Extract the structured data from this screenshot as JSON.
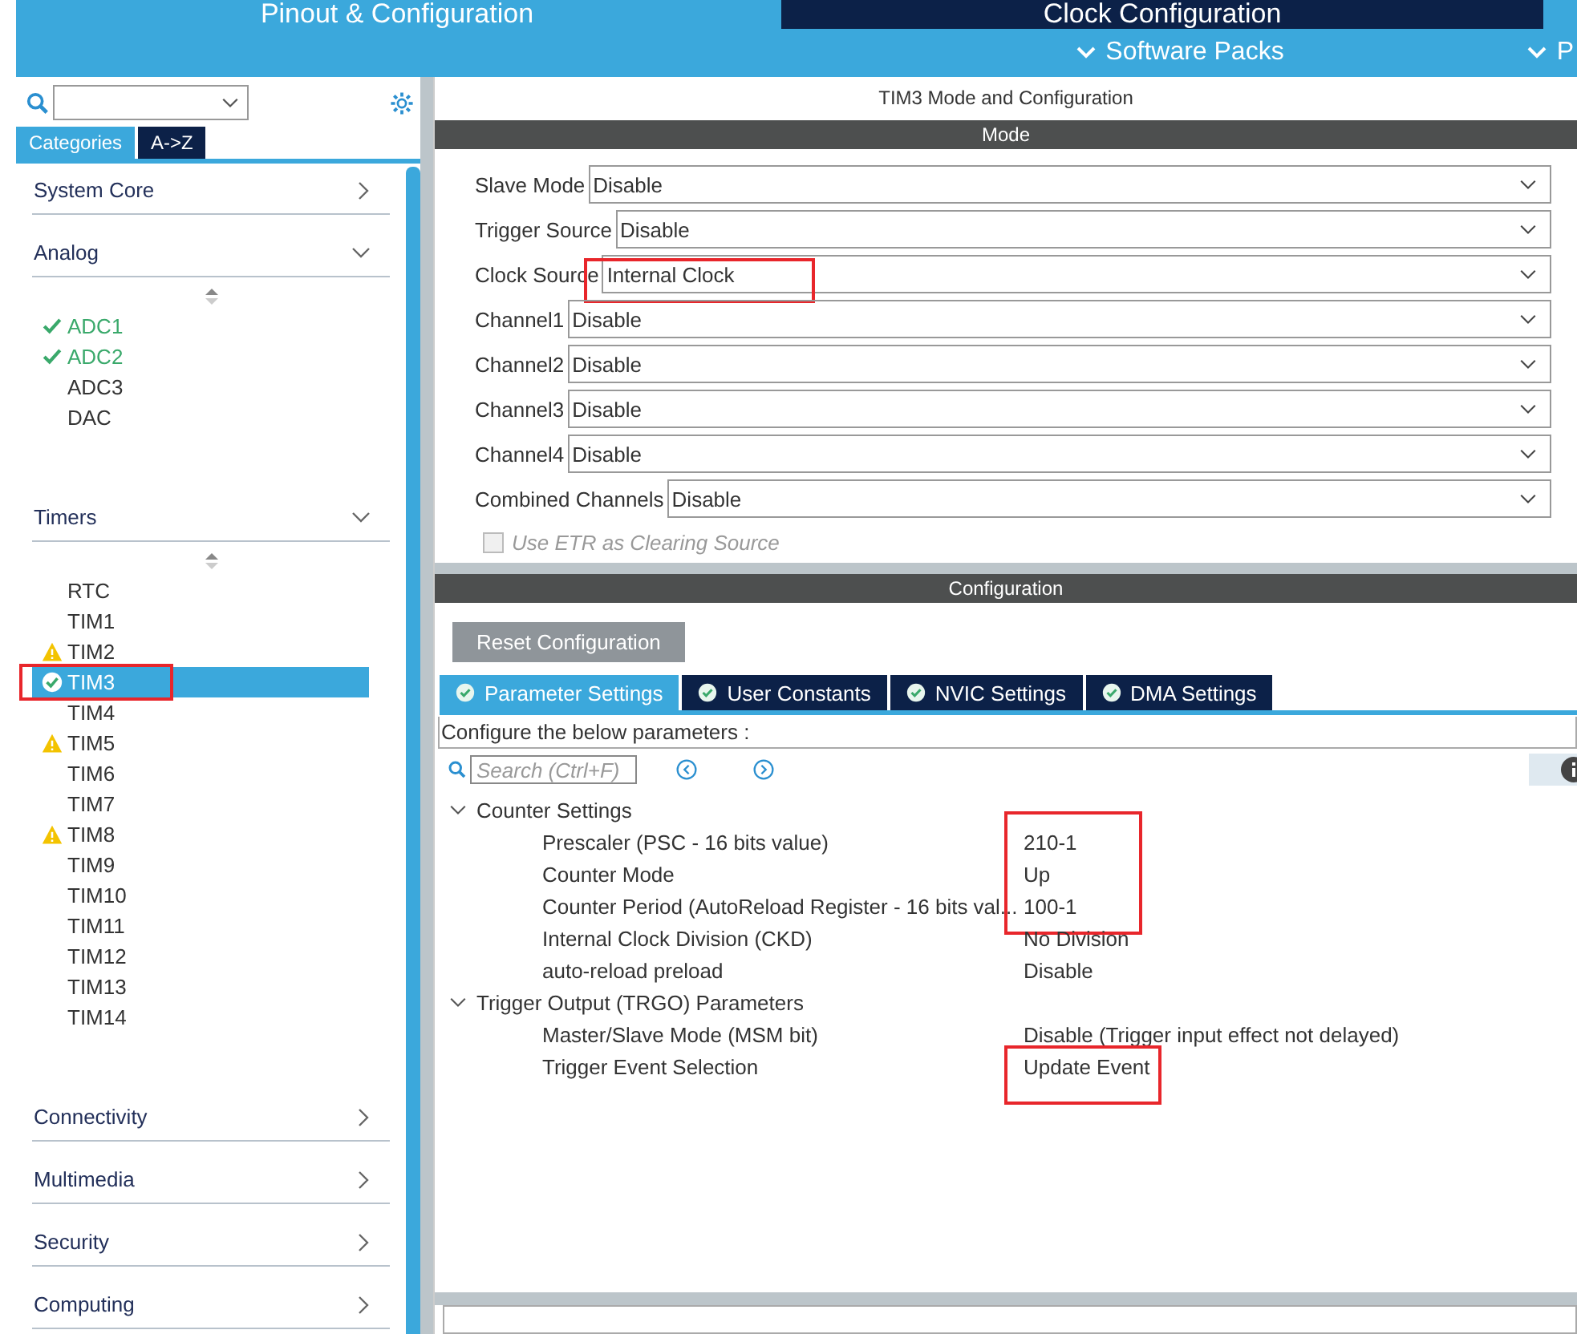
{
  "top_tabs": [
    {
      "label": "Pinout & Configuration",
      "selected": true
    },
    {
      "label": "Clock Configuration",
      "selected": false
    }
  ],
  "menus": [
    "Software Packs",
    "P"
  ],
  "sidebar": {
    "tabs": [
      {
        "label": "Categories",
        "selected": true
      },
      {
        "label": "A->Z",
        "selected": false
      }
    ],
    "groups": [
      {
        "label": "System Core",
        "expanded": false
      },
      {
        "label": "Analog",
        "expanded": true,
        "items": [
          {
            "label": "ADC1",
            "kind": "ok",
            "selected": false
          },
          {
            "label": "ADC2",
            "kind": "ok",
            "selected": false
          },
          {
            "label": "ADC3",
            "kind": "plain",
            "selected": false
          },
          {
            "label": "DAC",
            "kind": "plain",
            "selected": false
          }
        ]
      },
      {
        "label": "Timers",
        "expanded": true,
        "items": [
          {
            "label": "RTC",
            "kind": "plain",
            "selected": false
          },
          {
            "label": "TIM1",
            "kind": "plain",
            "selected": false
          },
          {
            "label": "TIM2",
            "kind": "warn",
            "selected": false
          },
          {
            "label": "TIM3",
            "kind": "ok",
            "selected": true,
            "highlighted": true
          },
          {
            "label": "TIM4",
            "kind": "plain",
            "selected": false
          },
          {
            "label": "TIM5",
            "kind": "warn",
            "selected": false
          },
          {
            "label": "TIM6",
            "kind": "plain",
            "selected": false
          },
          {
            "label": "TIM7",
            "kind": "plain",
            "selected": false
          },
          {
            "label": "TIM8",
            "kind": "warn",
            "selected": false
          },
          {
            "label": "TIM9",
            "kind": "plain",
            "selected": false
          },
          {
            "label": "TIM10",
            "kind": "plain",
            "selected": false
          },
          {
            "label": "TIM11",
            "kind": "plain",
            "selected": false
          },
          {
            "label": "TIM12",
            "kind": "plain",
            "selected": false
          },
          {
            "label": "TIM13",
            "kind": "plain",
            "selected": false
          },
          {
            "label": "TIM14",
            "kind": "plain",
            "selected": false
          }
        ]
      },
      {
        "label": "Connectivity",
        "expanded": false
      },
      {
        "label": "Multimedia",
        "expanded": false
      },
      {
        "label": "Security",
        "expanded": false
      },
      {
        "label": "Computing",
        "expanded": false
      }
    ]
  },
  "panel_title": "TIM3 Mode and Configuration",
  "mode": {
    "title": "Mode",
    "fields": [
      {
        "label": "Slave Mode",
        "value": "Disable"
      },
      {
        "label": "Trigger Source",
        "value": "Disable"
      },
      {
        "label": "Clock Source",
        "value": "Internal Clock",
        "highlighted": true
      },
      {
        "label": "Channel1",
        "value": "Disable"
      },
      {
        "label": "Channel2",
        "value": "Disable"
      },
      {
        "label": "Channel3",
        "value": "Disable"
      },
      {
        "label": "Channel4",
        "value": "Disable"
      },
      {
        "label": "Combined Channels",
        "value": "Disable"
      }
    ],
    "checkbox": {
      "label": "Use ETR as Clearing Source",
      "checked": false,
      "disabled": true
    }
  },
  "configuration": {
    "title": "Configuration",
    "reset_button": "Reset Configuration",
    "tabs": [
      {
        "label": "Parameter Settings",
        "selected": true
      },
      {
        "label": "User Constants",
        "selected": false
      },
      {
        "label": "NVIC Settings",
        "selected": false
      },
      {
        "label": "DMA Settings",
        "selected": false
      }
    ],
    "hint": "Configure the below parameters :",
    "search": {
      "placeholder": "Search (Ctrl+F)"
    },
    "groups": [
      {
        "label": "Counter Settings",
        "expanded": true,
        "params": [
          {
            "name": "Prescaler (PSC - 16 bits value)",
            "value": "210-1",
            "highlighted": true
          },
          {
            "name": "Counter Mode",
            "value": "Up",
            "highlighted": true
          },
          {
            "name": "Counter Period (AutoReload Register - 16 bits val...",
            "value": "100-1",
            "highlighted": true
          },
          {
            "name": "Internal Clock Division (CKD)",
            "value": "No Division"
          },
          {
            "name": "auto-reload preload",
            "value": "Disable"
          }
        ]
      },
      {
        "label": "Trigger Output (TRGO) Parameters",
        "expanded": true,
        "params": [
          {
            "name": "Master/Slave Mode (MSM bit)",
            "value": "Disable (Trigger input effect not delayed)"
          },
          {
            "name": "Trigger Event Selection",
            "value": "Update Event",
            "highlighted": true
          }
        ]
      }
    ]
  }
}
